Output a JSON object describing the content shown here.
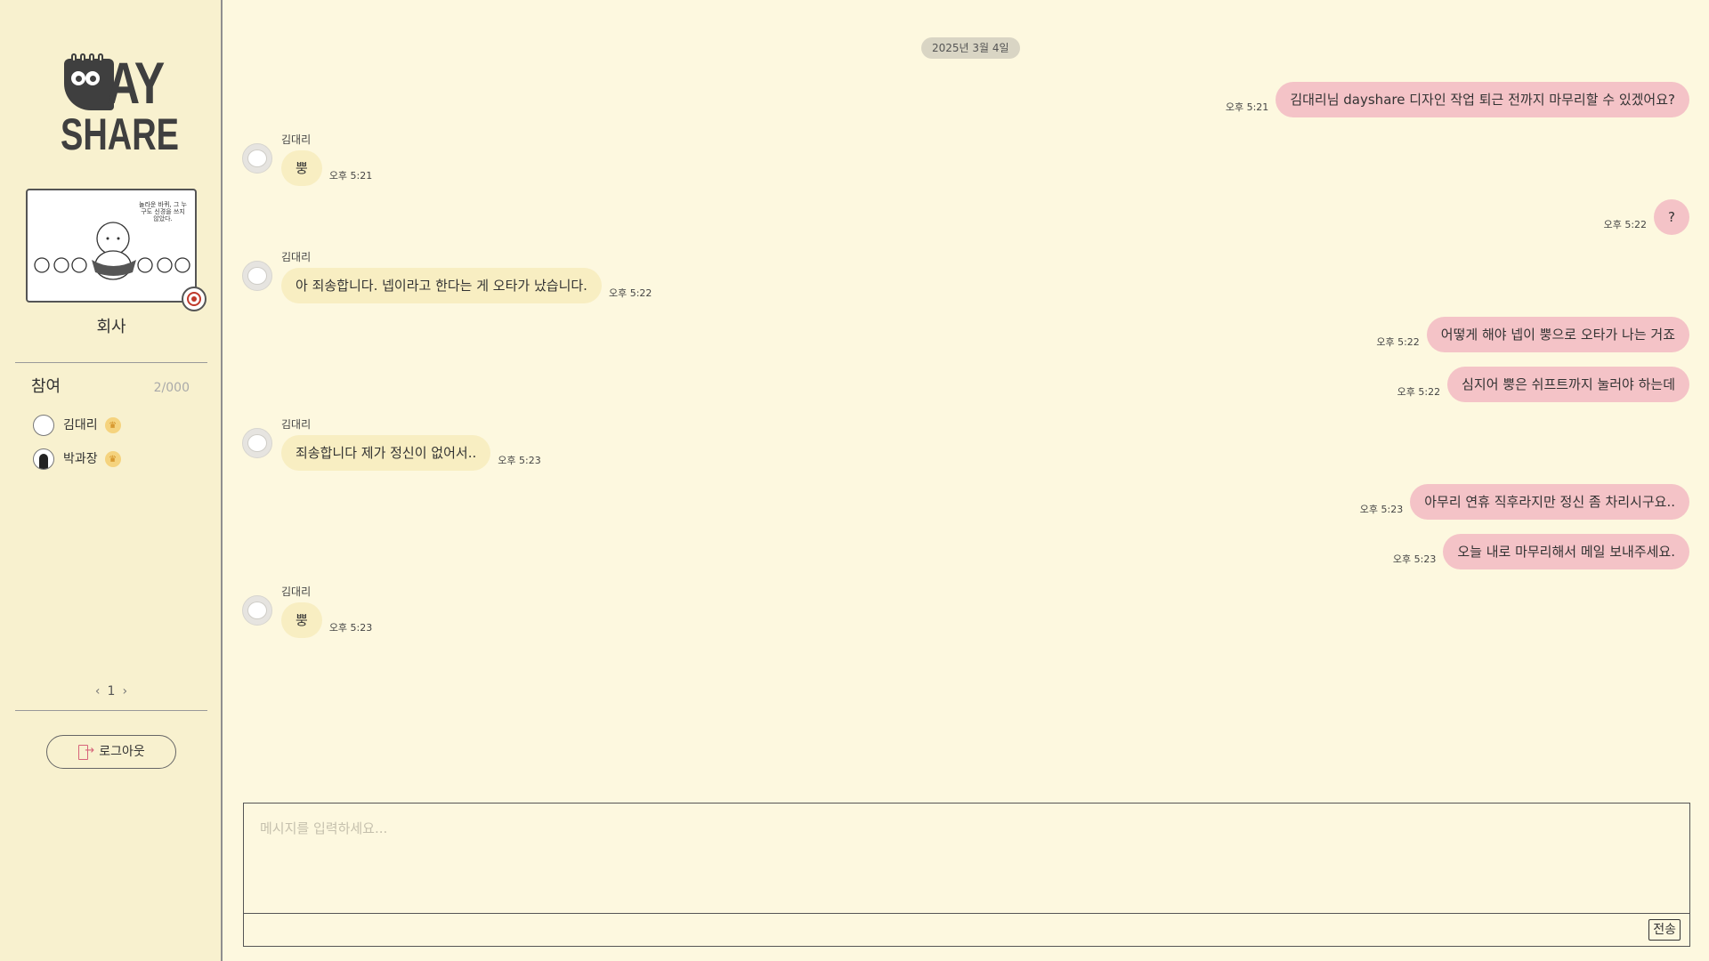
{
  "app": {
    "logo_text_top": "AY",
    "logo_text_bottom": "SHARE"
  },
  "sidebar": {
    "room_image_caption": "놀라운 바퀴, 그 누구도 신경을 쓰지 않았다.",
    "room_name": "회사",
    "participants_title": "참여",
    "participants_count": "2/000",
    "members": [
      {
        "name": "김대리",
        "avatar": "blank-avatar"
      },
      {
        "name": "박과장",
        "avatar": "dark-avatar"
      }
    ],
    "page_current": "1",
    "logout_label": "로그아웃"
  },
  "chat": {
    "date_label": "2025년 3월 4일",
    "messages": [
      {
        "side": "mine",
        "text": "김대리님 dayshare 디자인 작업 퇴근 전까지 마무리할 수 있겠어요?",
        "time": "오후 5:21"
      },
      {
        "side": "theirs",
        "sender": "김대리",
        "text": "뿡",
        "time": "오후 5:21"
      },
      {
        "side": "mine",
        "text": "?",
        "time": "오후 5:22"
      },
      {
        "side": "theirs",
        "sender": "김대리",
        "text": "아 죄송합니다. 넵이라고 한다는 게 오타가 났습니다.",
        "time": "오후 5:22"
      },
      {
        "side": "mine",
        "text": "어떻게 해야 넵이 뿡으로 오타가 나는 거죠",
        "time": "오후 5:22"
      },
      {
        "side": "mine",
        "text": "심지어 뿡은 쉬프트까지 눌러야 하는데",
        "time": "오후 5:22"
      },
      {
        "side": "theirs",
        "sender": "김대리",
        "text": "죄송합니다 제가 정신이 없어서..",
        "time": "오후 5:23"
      },
      {
        "side": "mine",
        "text": "아무리 연휴 직후라지만 정신 좀 차리시구요..",
        "time": "오후 5:23"
      },
      {
        "side": "mine",
        "text": "오늘 내로 마무리해서 메일 보내주세요.",
        "time": "오후 5:23"
      },
      {
        "side": "theirs",
        "sender": "김대리",
        "text": "뿡",
        "time": "오후 5:23"
      }
    ]
  },
  "composer": {
    "placeholder": "메시지를 입력하세요...",
    "send_label": "전송"
  },
  "colors": {
    "background": "#fdf8df",
    "sidebar": "#f8f1cf",
    "my_bubble": "#f4c3c7",
    "their_bubble": "#f8eec2"
  }
}
